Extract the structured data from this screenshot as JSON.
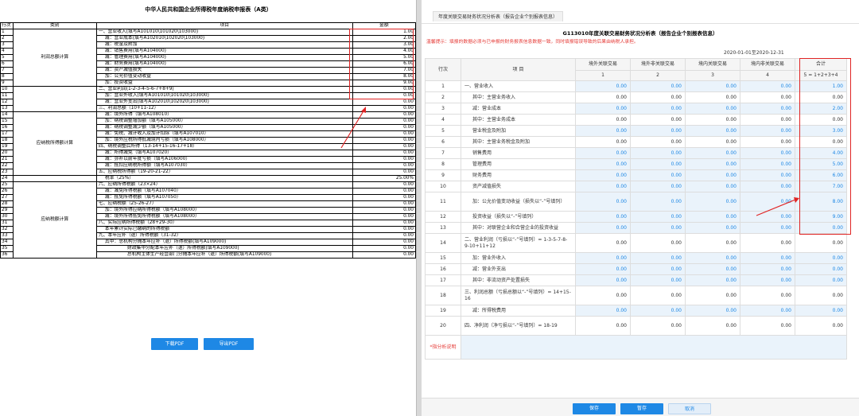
{
  "left_panel": {
    "title": "中华人民共和国企业所得税年度纳税申报表（A类）",
    "headers": [
      "行次",
      "类别",
      "项目",
      "金额"
    ],
    "rows": [
      {
        "n": "1",
        "item": "一、营业收入(填写A101010\\101020\\103000)",
        "amount": "1.00"
      },
      {
        "n": "2",
        "item": "减：营业成本(填写A102010\\102020\\103000)",
        "amount": "2.00"
      },
      {
        "n": "3",
        "item": "减：税金及附加",
        "amount": "3.00"
      },
      {
        "n": "4",
        "item": "减：销售费用(填写A104000)",
        "amount": "4.00"
      },
      {
        "n": "5",
        "item": "减：管理费用(填写A104000)",
        "amount": "5.00"
      },
      {
        "n": "6",
        "item": "减：财务费用(填写A104000)",
        "amount": "6.00"
      },
      {
        "n": "7",
        "item": "减：资产减值损失",
        "amount": "7.00"
      },
      {
        "n": "8",
        "item": "加：公允价值变动收益",
        "amount": "8.00"
      },
      {
        "n": "9",
        "item": "加：投资收益",
        "amount": "9.00"
      },
      {
        "n": "10",
        "item": "二、营业利润(1-2-3-4-5-6-7+8+9)",
        "amount": "0.00"
      },
      {
        "n": "11",
        "item": "加：营业外收入(填写A101010\\101020\\103000)",
        "amount": "0.00"
      },
      {
        "n": "12",
        "item": "减：营业外支出(填写A102010\\102020\\103000)",
        "amount": "0.00"
      },
      {
        "n": "13",
        "item": "三、利润总额（10+11-12）",
        "amount": "0.00"
      },
      {
        "n": "14",
        "item": "减：境外所得（填写A108010）",
        "amount": "0.00"
      },
      {
        "n": "15",
        "item": "加：纳税调整增加额（填写A105000）",
        "amount": "0.00"
      },
      {
        "n": "16",
        "item": "减：纳税调整减少额（填写A105000）",
        "amount": "0.00"
      },
      {
        "n": "17",
        "item": "减：免税、减计收入及加计扣除（填写A107010）",
        "amount": "0.00"
      },
      {
        "n": "18",
        "item": "加：境外应税所得抵减境内亏损（填写A108000）",
        "amount": "0.00"
      },
      {
        "n": "19",
        "item": "四、纳税调整后所得（13-14+15-16-17+18）",
        "amount": "0.00"
      },
      {
        "n": "20",
        "item": "减：所得减免（填写A107020）",
        "amount": "0.00"
      },
      {
        "n": "21",
        "item": "减：弥补以前年度亏损（填写A106000）",
        "amount": "0.00"
      },
      {
        "n": "22",
        "item": "减：抵扣应纳税所得额（填写A107030）",
        "amount": "0.00"
      },
      {
        "n": "23",
        "item": "五、应纳税所得额（19-20-21-22）",
        "amount": "0.00"
      },
      {
        "n": "24",
        "item": "税率（25%）",
        "amount": "25.00%"
      },
      {
        "n": "25",
        "item": "六、应纳所得税额（23×24）",
        "amount": "0.00"
      },
      {
        "n": "26",
        "item": "减：减免所得税额（填写A107040）",
        "amount": "0.00"
      },
      {
        "n": "27",
        "item": "减：抵免所得税额（填写A107050）",
        "amount": "0.00"
      },
      {
        "n": "28",
        "item": "七、应纳税额（25-26-27）",
        "amount": "0.00"
      },
      {
        "n": "29",
        "item": "加：境外所得应纳所得税额（填写A108000）",
        "amount": "0.00"
      },
      {
        "n": "30",
        "item": "减：境外所得抵免所得税额（填写A108000）",
        "amount": "0.00"
      },
      {
        "n": "31",
        "item": "八、实际应纳所得税额（28+29-30）",
        "amount": "0.00"
      },
      {
        "n": "32",
        "item": "本年累计实际已缴纳的所得税额",
        "amount": "0.00"
      },
      {
        "n": "33",
        "item": "九、本年应补（退）所得税额（31-32）",
        "amount": "0.00"
      },
      {
        "n": "34",
        "item": "其中：总机构分摊本年应补（退）所得税额(填写A109000)",
        "amount": "0.00"
      },
      {
        "n": "35",
        "item": "财政集中分配本年应补（退）所得税额(填写A109000)",
        "amount": "0.00"
      },
      {
        "n": "36",
        "item": "总机构主体生产经营部门分摊本年应补（退）所得税额(填写A109000)",
        "amount": "0.00"
      }
    ],
    "categories": [
      "利润总额计算",
      "应纳税所得额计算",
      "应纳税额计算"
    ],
    "buttons": {
      "download": "下载PDF",
      "export": "导出PDF"
    }
  },
  "right_panel": {
    "tab_label": "年度关联交易财务状况分析表（报告企业个别报表信息）",
    "form_title": "G113010年度关联交易财务状况分析表（报告企业个别报表信息）",
    "warning": "温馨提示：填报的数据必须与已申报的财务报表信息数据一致，同时填报错误导致的后果由纳税人承担。",
    "date_range": "2020-01-01至2020-12-31",
    "headers": [
      "行次",
      "项 目",
      "境外关联交易",
      "境外非关联交易",
      "境内关联交易",
      "境内非关联交易",
      "合计"
    ],
    "subheaders": [
      "1",
      "2",
      "3",
      "4",
      "5 = 1+2+3+4"
    ],
    "rows": [
      {
        "n": "1",
        "item": "一、营业收入",
        "v": [
          "0.00",
          "0.00",
          "0.00",
          "0.00"
        ],
        "total": "1.00",
        "blue": true
      },
      {
        "n": "2",
        "item": "其中：主营业务收入",
        "v": [
          "0.00",
          "0.00",
          "0.00",
          "0.00"
        ],
        "total": "0.00",
        "blue": false
      },
      {
        "n": "3",
        "item": "减：营业成本",
        "v": [
          "0.00",
          "0.00",
          "0.00",
          "0.00"
        ],
        "total": "2.00",
        "blue": true
      },
      {
        "n": "4",
        "item": "其中：主营业务成本",
        "v": [
          "0.00",
          "0.00",
          "0.00",
          "0.00"
        ],
        "total": "0.00",
        "blue": false
      },
      {
        "n": "5",
        "item": "营业税金及附加",
        "v": [
          "0.00",
          "0.00",
          "0.00",
          "0.00"
        ],
        "total": "3.00",
        "blue": true
      },
      {
        "n": "6",
        "item": "其中：主营业务税金及附加",
        "v": [
          "0.00",
          "0.00",
          "0.00",
          "0.00"
        ],
        "total": "0.00",
        "blue": false
      },
      {
        "n": "7",
        "item": "销售费用",
        "v": [
          "0.00",
          "0.00",
          "0.00",
          "0.00"
        ],
        "total": "4.00",
        "blue": true
      },
      {
        "n": "8",
        "item": "管理费用",
        "v": [
          "0.00",
          "0.00",
          "0.00",
          "0.00"
        ],
        "total": "5.00",
        "blue": true
      },
      {
        "n": "9",
        "item": "财务费用",
        "v": [
          "0.00",
          "0.00",
          "0.00",
          "0.00"
        ],
        "total": "6.00",
        "blue": true
      },
      {
        "n": "10",
        "item": "资产减值损失",
        "v": [
          "0.00",
          "0.00",
          "0.00",
          "0.00"
        ],
        "total": "7.00",
        "blue": true
      },
      {
        "n": "11",
        "item": "加：公允价值变动收益（损失以“-”号填列）",
        "v": [
          "0.00",
          "0.00",
          "0.00",
          "0.00"
        ],
        "total": "8.00",
        "blue": true
      },
      {
        "n": "12",
        "item": "投资收益（损失以“-”号填列）",
        "v": [
          "0.00",
          "0.00",
          "0.00",
          "0.00"
        ],
        "total": "9.00",
        "blue": true
      },
      {
        "n": "13",
        "item": "其中：对联营企业和合营企业的投资收益",
        "v": [
          "0.00",
          "0.00",
          "0.00",
          "0.00"
        ],
        "total": "0.00",
        "blue": true
      },
      {
        "n": "14",
        "item": "二、营业利润（亏损以“-”号填列）= 1-3-5-7-8-9-10+11+12",
        "v": [
          "0.00",
          "0.00",
          "0.00",
          "0.00"
        ],
        "total": "0.00",
        "blue": false
      },
      {
        "n": "15",
        "item": "加：营业外收入",
        "v": [
          "0.00",
          "0.00",
          "0.00",
          "0.00"
        ],
        "total": "0.00",
        "blue": true
      },
      {
        "n": "16",
        "item": "减：营业外支出",
        "v": [
          "0.00",
          "0.00",
          "0.00",
          "0.00"
        ],
        "total": "0.00",
        "blue": true
      },
      {
        "n": "17",
        "item": "其中：非流动资产处置损失",
        "v": [
          "0.00",
          "0.00",
          "0.00",
          "0.00"
        ],
        "total": "0.00",
        "blue": true
      },
      {
        "n": "18",
        "item": "三、利润总额（亏损总额以“-”号填列）= 14+15-16",
        "v": [
          "0.00",
          "0.00",
          "0.00",
          "0.00"
        ],
        "total": "0.00",
        "blue": false
      },
      {
        "n": "19",
        "item": "减：所得税费用",
        "v": [
          "0.00",
          "0.00",
          "0.00",
          "0.00"
        ],
        "total": "0.00",
        "blue": true
      },
      {
        "n": "20",
        "item": "四、净利润（净亏损以“-”号填列）= 18-19",
        "v": [
          "0.00",
          "0.00",
          "0.00",
          "0.00"
        ],
        "total": "0.00",
        "blue": false
      }
    ],
    "note_label": "*指分析说明",
    "buttons": {
      "save": "保存",
      "temp_save": "暂存",
      "cancel": "取消"
    }
  },
  "colors": {
    "accent": "#1e88e5",
    "highlight": "#e02424",
    "warning": "#e53935"
  }
}
